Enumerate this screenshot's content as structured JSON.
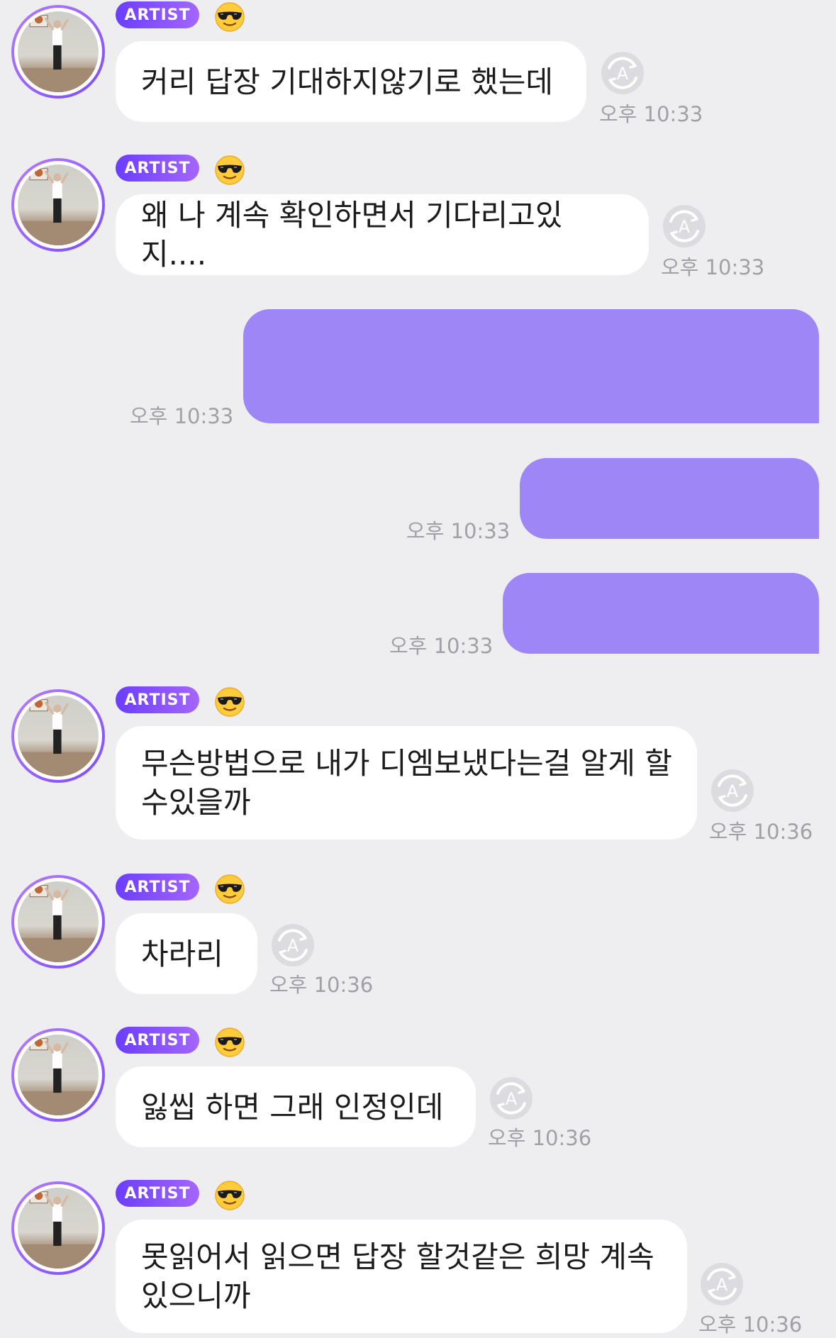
{
  "artist_badge_label": "ARTIST",
  "artist_avatar_icon": "basketball-player-avatar",
  "artist_emoji_icon": "sunglasses-face-emoji",
  "read_status_icon": "read-receipt-a-icon",
  "colors": {
    "background": "#eeeef0",
    "incoming_bubble": "#ffffff",
    "outgoing_bubble": "#9e86f6",
    "badge_gradient_start": "#6a3dff",
    "badge_gradient_end": "#a466ff",
    "timestamp": "#a0a0a6"
  },
  "messages": [
    {
      "sender": "artist",
      "text": "커리 답장 기대하지않기로 했는데",
      "time": "오후 10:33"
    },
    {
      "sender": "artist",
      "text": "왜 나 계속 확인하면서 기다리고있지....",
      "time": "오후 10:33"
    },
    {
      "sender": "me",
      "text": "",
      "time": "오후 10:33"
    },
    {
      "sender": "me",
      "text": "",
      "time": "오후 10:33"
    },
    {
      "sender": "me",
      "text": "",
      "time": "오후 10:33"
    },
    {
      "sender": "artist",
      "text": "무슨방법으로 내가 디엠보냈다는걸 알게 할 수있을까",
      "time": "오후 10:36"
    },
    {
      "sender": "artist",
      "text": "차라리",
      "time": "오후 10:36"
    },
    {
      "sender": "artist",
      "text": "잃씹 하면 그래 인정인데",
      "time": "오후 10:36"
    },
    {
      "sender": "artist",
      "text": "못읽어서 읽으면 답장 할것같은 희망 계속 있으니까",
      "time": "오후 10:36"
    }
  ]
}
